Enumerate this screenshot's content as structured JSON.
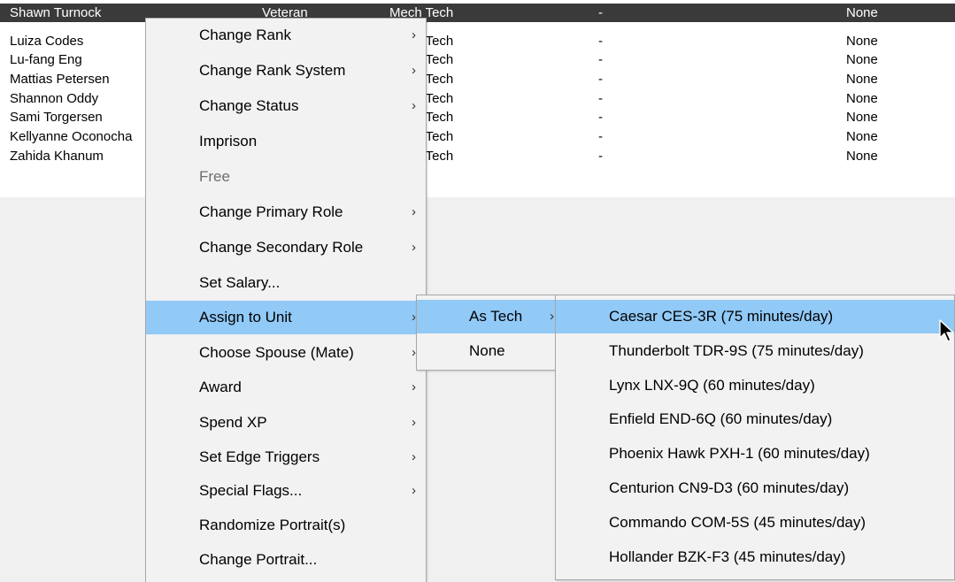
{
  "personnel_table": {
    "rows": [
      {
        "name": "Shawn Turnock",
        "rank": "Veteran",
        "role": "Mech Tech",
        "dash": "-",
        "unit": "None"
      },
      {
        "name": "Luiza Codes",
        "rank": "",
        "role": "Mech Tech",
        "dash": "-",
        "unit": "None"
      },
      {
        "name": "Lu-fang Eng",
        "rank": "",
        "role": "Mech Tech",
        "dash": "-",
        "unit": "None"
      },
      {
        "name": "Mattias Petersen",
        "rank": "",
        "role": "Mech Tech",
        "dash": "-",
        "unit": "None"
      },
      {
        "name": "Shannon Oddy",
        "rank": "",
        "role": "Mech Tech",
        "dash": "-",
        "unit": "None"
      },
      {
        "name": "Sami Torgersen",
        "rank": "",
        "role": "Mech Tech",
        "dash": "-",
        "unit": "None"
      },
      {
        "name": "Kellyanne Oconocha",
        "rank": "",
        "role": "Mech Tech",
        "dash": "-",
        "unit": "None"
      },
      {
        "name": "Zahida Khanum",
        "rank": "",
        "role": "Mech Tech",
        "dash": "-",
        "unit": "None"
      }
    ]
  },
  "context_menu": {
    "items": [
      {
        "label": "Change Rank",
        "submenu_arrow": "›"
      },
      {
        "label": "Change Rank System",
        "submenu_arrow": "›"
      },
      {
        "label": "Change Status",
        "submenu_arrow": "›"
      },
      {
        "label": "Imprison",
        "submenu_arrow": ""
      },
      {
        "label": "Free",
        "submenu_arrow": ""
      },
      {
        "label": "Change Primary Role",
        "submenu_arrow": "›"
      },
      {
        "label": "Change Secondary Role",
        "submenu_arrow": "›"
      },
      {
        "label": "Set Salary...",
        "submenu_arrow": ""
      },
      {
        "label": "Assign to Unit",
        "submenu_arrow": "›"
      },
      {
        "label": "Choose Spouse (Mate)",
        "submenu_arrow": "›"
      },
      {
        "label": "Award",
        "submenu_arrow": "›"
      },
      {
        "label": "Spend XP",
        "submenu_arrow": "›"
      },
      {
        "label": "Set Edge Triggers",
        "submenu_arrow": "›"
      },
      {
        "label": "Special Flags...",
        "submenu_arrow": "›"
      },
      {
        "label": "Randomize Portrait(s)",
        "submenu_arrow": ""
      },
      {
        "label": "Change Portrait...",
        "submenu_arrow": ""
      }
    ]
  },
  "assign_submenu": {
    "items": [
      {
        "label": "As Tech",
        "submenu_arrow": "›"
      },
      {
        "label": "None",
        "submenu_arrow": ""
      }
    ]
  },
  "unit_submenu": {
    "items": [
      {
        "label": "Caesar CES-3R (75 minutes/day)"
      },
      {
        "label": "Thunderbolt TDR-9S (75 minutes/day)"
      },
      {
        "label": "Lynx LNX-9Q (60 minutes/day)"
      },
      {
        "label": "Enfield END-6Q (60 minutes/day)"
      },
      {
        "label": "Phoenix Hawk PXH-1 (60 minutes/day)"
      },
      {
        "label": "Centurion CN9-D3 (60 minutes/day)"
      },
      {
        "label": "Commando COM-5S (45 minutes/day)"
      },
      {
        "label": "Hollander BZK-F3 (45 minutes/day)"
      }
    ]
  },
  "colors": {
    "selected_row": "#3a3a3a",
    "menu_highlight": "#91c9f7",
    "menu_background": "#f2f2f2",
    "disabled_text": "#6d6d6d"
  }
}
